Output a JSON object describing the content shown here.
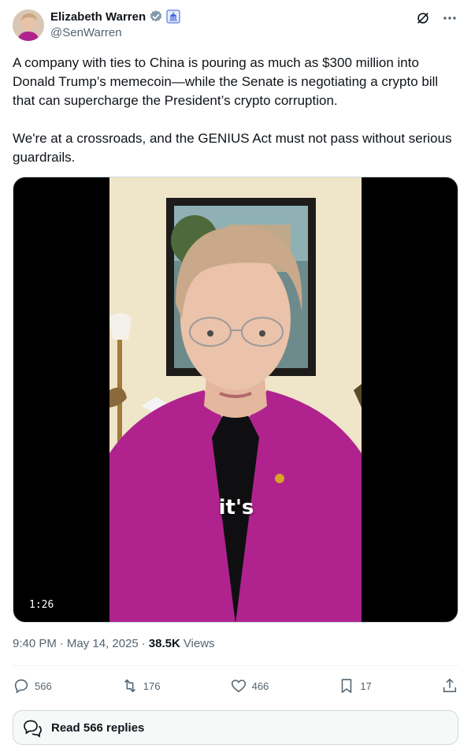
{
  "author": {
    "display_name": "Elizabeth Warren",
    "handle": "@SenWarren",
    "verified_icon": "verified-badge-icon",
    "affiliation_icon": "capitol-badge-icon"
  },
  "tweet": {
    "text": "A company with ties to China is pouring as much as $300 million into Donald Trump’s memecoin—while the Senate is negotiating a crypto bill that can supercharge the President’s crypto corruption.\n\nWe're at a crossroads, and the GENIUS Act must not pass without serious guardrails."
  },
  "video": {
    "duration": "1:26",
    "caption": "it's"
  },
  "meta": {
    "time": "9:40 PM",
    "separator": "·",
    "date": "May 14, 2025",
    "separator2": "·",
    "views_count": "38.5K",
    "views_label": "Views"
  },
  "actions": {
    "replies": "566",
    "reposts": "176",
    "likes": "466",
    "bookmarks": "17"
  },
  "read_replies": {
    "label": "Read 566 replies"
  },
  "colors": {
    "text": "#0f1419",
    "muted": "#536471",
    "verified": "#829aab",
    "jacket": "#b0238e"
  }
}
